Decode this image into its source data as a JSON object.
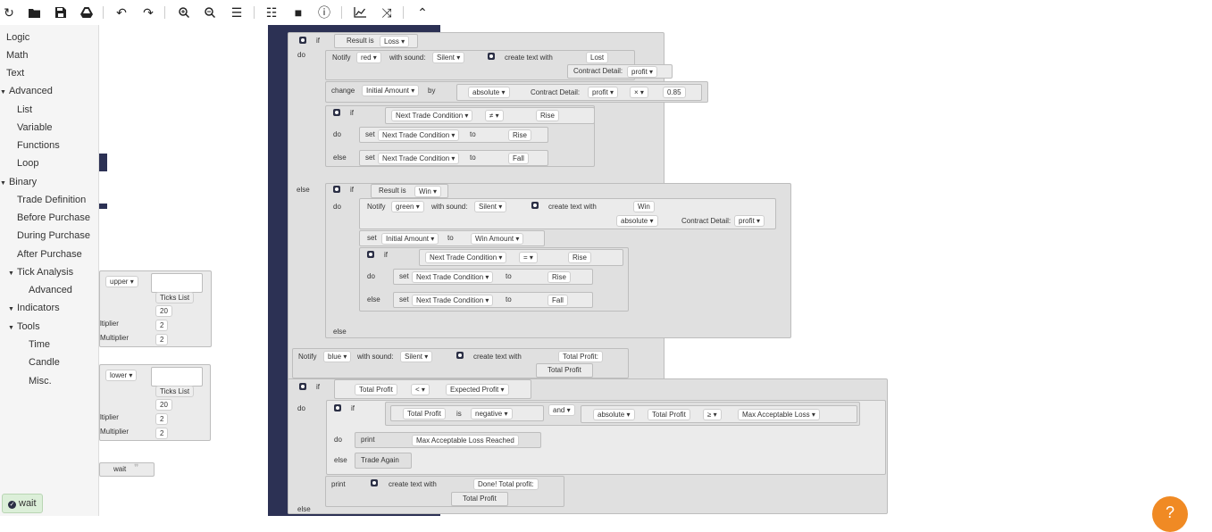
{
  "toolbar": {
    "buttons": [
      {
        "name": "reset-icon",
        "glyph": "↻"
      },
      {
        "name": "open-folder-icon",
        "glyph": "📁"
      },
      {
        "name": "save-icon",
        "glyph": "💾"
      },
      {
        "name": "drive-icon",
        "glyph": "▲"
      },
      {
        "name": "undo-icon",
        "glyph": "↶"
      },
      {
        "name": "redo-icon",
        "glyph": "↷"
      },
      {
        "name": "zoom-in-icon",
        "glyph": "🔍"
      },
      {
        "name": "zoom-out-icon",
        "glyph": "🔍"
      },
      {
        "name": "sort-icon",
        "glyph": "☰"
      },
      {
        "name": "list-icon",
        "glyph": "☷"
      },
      {
        "name": "stop-icon",
        "glyph": "■"
      },
      {
        "name": "info-icon",
        "glyph": "ⓘ"
      },
      {
        "name": "chart-icon",
        "glyph": "📈"
      },
      {
        "name": "trade-view-icon",
        "glyph": "⤨"
      },
      {
        "name": "collapse-icon",
        "glyph": "⌃"
      }
    ]
  },
  "toolbox": {
    "categories": [
      {
        "label": "Logic"
      },
      {
        "label": "Math"
      },
      {
        "label": "Text"
      },
      {
        "label": "Advanced",
        "expanded": true
      },
      {
        "label": "List"
      },
      {
        "label": "Variable"
      },
      {
        "label": "Functions"
      },
      {
        "label": "Loop"
      },
      {
        "label": "Binary",
        "expanded": true
      },
      {
        "label": "Trade Definition"
      },
      {
        "label": "Before Purchase"
      },
      {
        "label": "During Purchase"
      },
      {
        "label": "After Purchase"
      },
      {
        "label": "Tick Analysis",
        "expanded": true
      },
      {
        "label": "Advanced"
      },
      {
        "label": "Indicators",
        "expanded": true
      },
      {
        "label": "Tools",
        "expanded": true
      },
      {
        "label": "Time"
      },
      {
        "label": "Candle"
      },
      {
        "label": "Misc."
      }
    ]
  },
  "status": {
    "label": "wait"
  },
  "help": {
    "glyph": "?"
  },
  "flyout_blocks": {
    "upper": {
      "dropdown": "upper",
      "ticks_list": "Ticks List",
      "v1": "20",
      "v2": "2",
      "v3": "2",
      "l1": "ltiplier",
      "l2": "Multiplier"
    },
    "lower": {
      "dropdown": "lower",
      "ticks_list": "Ticks List",
      "v1": "20",
      "v2": "2",
      "v3": "2",
      "l1": "ltiplier",
      "l2": "Multiplier"
    },
    "wait": {
      "label": "wait"
    }
  },
  "words": {
    "if": "if",
    "do": "do",
    "else": "else",
    "notify": "Notify",
    "with_sound": "with sound:",
    "create_text_with": "create text with",
    "change": "change",
    "by": "by",
    "set": "set",
    "to": "to",
    "is": "is",
    "print": "print",
    "and": "and",
    "result_is": "Result is",
    "contract_detail": "Contract Detail:"
  },
  "blocks": {
    "loss_val": "Loss",
    "red": "red",
    "silent": "Silent",
    "lost": "Lost",
    "profit": "profit",
    "initial_amount": "Initial Amount",
    "absolute": "absolute",
    "mul": "×",
    "factor": "0.85",
    "next_trade_condition": "Next Trade Condition",
    "neq": "≠",
    "eq": "=",
    "rise": "Rise",
    "fall": "Fall",
    "win": "Win",
    "green": "green",
    "win_amount": "Win Amount",
    "blue": "blue",
    "total_profit_colon": "Total Profit:",
    "total_profit": "Total Profit",
    "lt": "<",
    "expected_profit": "Expected Profit",
    "negative": "negative",
    "ge": "≥",
    "max_acceptable_loss": "Max Acceptable Loss",
    "max_loss_reached": "Max Acceptable Loss Reached",
    "trade_again": "Trade Again",
    "done_total_profit": "Done! Total profit:"
  }
}
